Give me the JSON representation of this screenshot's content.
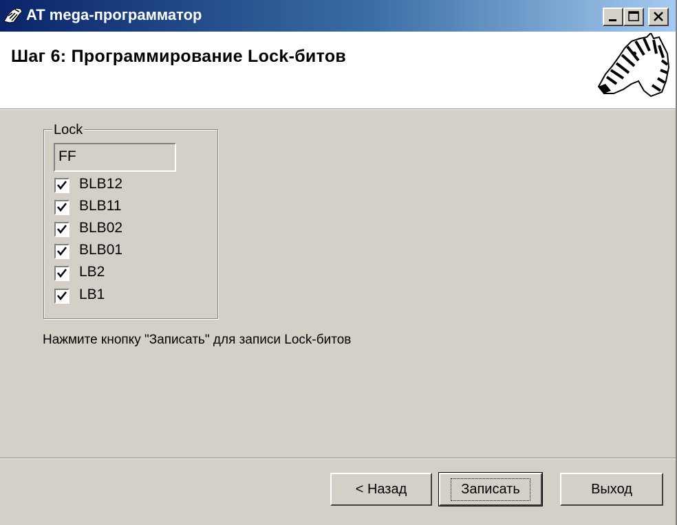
{
  "window": {
    "title": "AT mega-программатор",
    "colors": {
      "titlebar_start": "#0a246a",
      "titlebar_end": "#a6caf0",
      "face": "#d4d0c8"
    }
  },
  "header": {
    "title": "Шаг 6: Программирование Lock-битов",
    "logo": "zebra-logo"
  },
  "lock_group": {
    "legend": "Lock",
    "value": "FF",
    "bits": [
      {
        "label": "BLB12",
        "checked": true
      },
      {
        "label": "BLB11",
        "checked": true
      },
      {
        "label": "BLB02",
        "checked": true
      },
      {
        "label": "BLB01",
        "checked": true
      },
      {
        "label": "LB2",
        "checked": true
      },
      {
        "label": "LB1",
        "checked": true
      }
    ]
  },
  "hint": "Нажмите кнопку \"Записать\" для записи Lock-битов",
  "buttons": {
    "back": "< Назад",
    "write": "Записать",
    "exit": "Выход"
  }
}
